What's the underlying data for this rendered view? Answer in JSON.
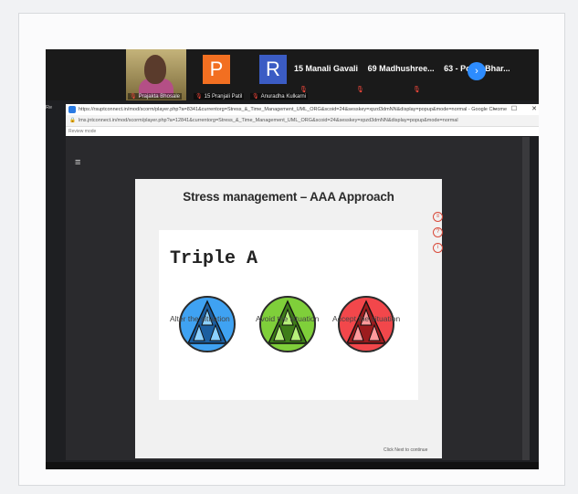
{
  "zoom": {
    "video_tile_name": "Prajakta Bhosale",
    "avatar_tiles": [
      {
        "letter": "P",
        "color": "#f26f21",
        "name": "15 Pranjali Patil"
      },
      {
        "letter": "R",
        "color": "#3b5cc4",
        "name": "Anuradha Kulkarni"
      }
    ],
    "names": [
      "15 Manali Gavali",
      "69 Madhushree...",
      "63 - Pooja Bhar..."
    ]
  },
  "browser": {
    "window_title": "https://rsuptconnect.in/mod/scorm/player.php?a=8341&currentorg=Stress_&_Time_Management_UML_ORG&scoid=24&sesskey=xpzd3dmNN&display=popup&mode=normal - Google Chrome",
    "url": "lms.jntconnect.in/mod/scorm/player.php?a=12841&currentorg=Stress_&_Time_Management_UML_ORG&scoid=24&sesskey=xpzd3dmNN&display=popup&mode=normal",
    "sub_label": "Review mode",
    "window_controls": [
      "–",
      "☐",
      "✕"
    ]
  },
  "slide": {
    "title": "Stress management – AAA Approach",
    "heading": "Triple A",
    "captions": [
      "Alter the situation",
      "Avoid the situation",
      "Accept the situation"
    ],
    "circle_colors": [
      "#3fa2f2",
      "#7fcf3a",
      "#f2474b"
    ],
    "footer": "Click Next to continue"
  }
}
